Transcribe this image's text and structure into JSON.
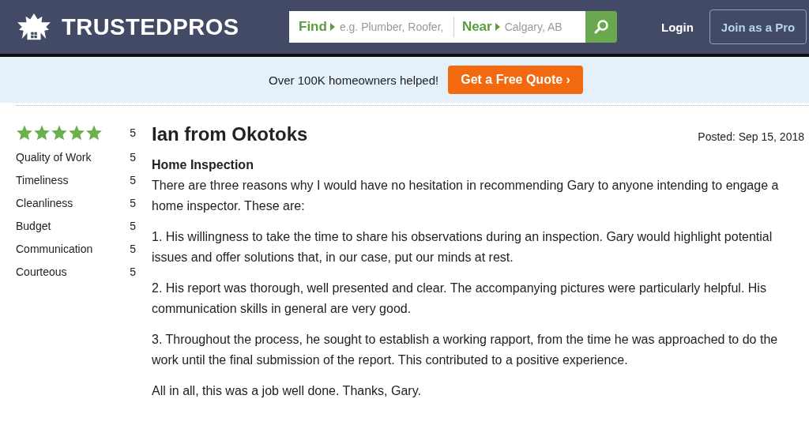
{
  "header": {
    "logo": "TRUSTEDPROS",
    "search": {
      "find_label": "Find",
      "find_placeholder": "e.g. Plumber, Roofer,",
      "near_label": "Near",
      "near_placeholder": "Calgary, AB"
    },
    "login": "Login",
    "join": "Join as a Pro"
  },
  "banner": {
    "text": "Over 100K homeowners helped!",
    "button": "Get a Free Quote",
    "button_arrow": "›"
  },
  "review": {
    "stars": 5,
    "overall": "5",
    "ratings": [
      {
        "label": "Quality of Work",
        "value": "5"
      },
      {
        "label": "Timeliness",
        "value": "5"
      },
      {
        "label": "Cleanliness",
        "value": "5"
      },
      {
        "label": "Budget",
        "value": "5"
      },
      {
        "label": "Communication",
        "value": "5"
      },
      {
        "label": "Courteous",
        "value": "5"
      }
    ],
    "author": "Ian from Okotoks",
    "posted": "Posted: Sep 15, 2018",
    "service": "Home Inspection",
    "paragraphs": [
      "There are three reasons why I would have no hesitation in recommending Gary to anyone intending to engage a home inspector. These are:",
      "1. His willingness to take the time to share his observations during an inspection. Gary would highlight potential issues and offer solutions that, in our case, put our minds at rest.",
      "2. His report was thorough, well presented and clear. The accompanying pictures were particularly helpful. His communication skills in general are very good.",
      "3. Throughout the process, he sought to establish a working rapport, from the time he was approached to do the work until the final submission of the report. This contributed to a positive experience.",
      "All in all, this was a job well done. Thanks, Gary."
    ]
  }
}
